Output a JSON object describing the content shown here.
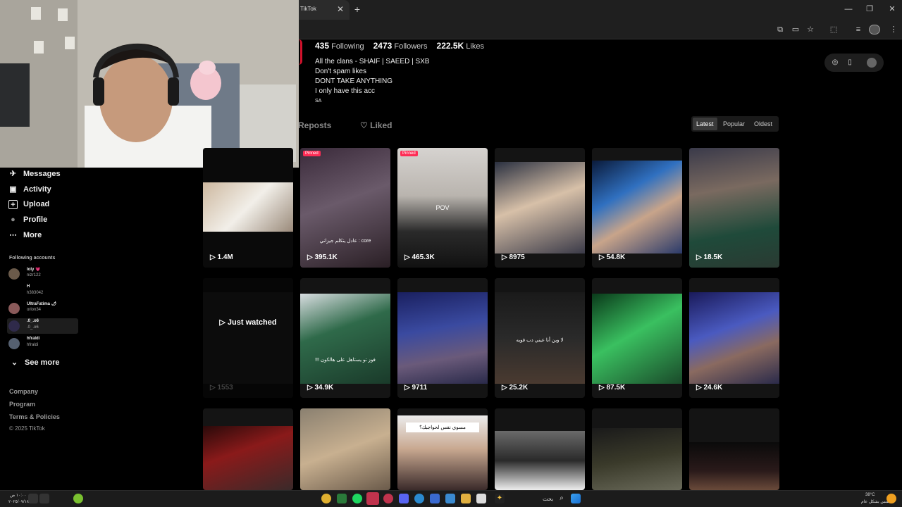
{
  "browser": {
    "tab_title": "TikTok",
    "close_glyph": "✕",
    "newtab_glyph": "+",
    "controls": [
      "—",
      "❐",
      "✕"
    ],
    "toolbar_icons": [
      "translate-icon",
      "cast-icon",
      "star-icon",
      "extensions-icon",
      "media-icon",
      "profile-avatar",
      "menu-icon"
    ]
  },
  "sidebar": {
    "nav": [
      {
        "label": "Messages",
        "icon": "✈"
      },
      {
        "label": "Activity",
        "icon": "▣"
      },
      {
        "label": "Upload",
        "icon": "+"
      },
      {
        "label": "Profile",
        "icon": "●"
      },
      {
        "label": "More",
        "icon": "⋯"
      }
    ],
    "following_title": "Following accounts",
    "accounts": [
      {
        "name": "loly 💗",
        "handle": "nizr122"
      },
      {
        "name": "H",
        "handle": "h383042"
      },
      {
        "name": "UltraFatima 🌶",
        "handle": "orlon34"
      },
      {
        "name": ".0_.o6",
        "handle": ".0_.o6"
      },
      {
        "name": "hfraldi",
        "handle": "hfraldi"
      }
    ],
    "see_more": "See more",
    "see_more_icon": "⌄",
    "footer": [
      "Company",
      "Program",
      "Terms & Policies"
    ],
    "copyright": "© 2025 TikTok"
  },
  "profile": {
    "following_count": "435",
    "following_label": "Following",
    "followers_count": "2473",
    "followers_label": "Followers",
    "likes_count": "222.5K",
    "likes_label": "Likes",
    "bio": [
      "All the clans - SHAIF | SAEED | SXB",
      "Don't spam likes",
      "DONT TAKE ANYTHING",
      "I only have this acc"
    ],
    "region": "SA"
  },
  "tabs": {
    "reposts": "Reposts",
    "liked": "Liked",
    "liked_icon": "♡"
  },
  "sort": {
    "latest": "Latest",
    "popular": "Popular",
    "oldest": "Oldest"
  },
  "play_icon": "▷",
  "videos_row1": [
    {
      "views": "1.4M",
      "caption": "",
      "pinned": false
    },
    {
      "views": "395.1K",
      "caption": "عادل يتكلم جيزاني : core",
      "pinned": true
    },
    {
      "views": "465.3K",
      "caption": "POV",
      "pinned": true
    },
    {
      "views": "8975",
      "caption": "",
      "pinned": false
    },
    {
      "views": "54.8K",
      "caption": "",
      "pinned": false
    },
    {
      "views": "18.5K",
      "caption": "",
      "pinned": false
    }
  ],
  "pinned_label": "Pinned",
  "videos_row2": [
    {
      "views": "1553",
      "caption": ""
    },
    {
      "views": "34.9K",
      "caption": "!!! فوز تو يستاهل على هالكون"
    },
    {
      "views": "9711",
      "caption": ""
    },
    {
      "views": "25.2K",
      "caption": "لا وين أنا عيني دب فويه"
    },
    {
      "views": "87.5K",
      "caption": ""
    },
    {
      "views": "24.6K",
      "caption": ""
    }
  ],
  "just_watched": "Just watched",
  "row3_caption": "مسوي نفس لحواجبك؟",
  "taskbar": {
    "time": "١٠:٠٠ ص",
    "date": "٢٠٢٥/٠٧/١٨",
    "weather_temp": "38°C",
    "weather_desc": "مشمس بشكل عام",
    "search_label": "بحث"
  }
}
